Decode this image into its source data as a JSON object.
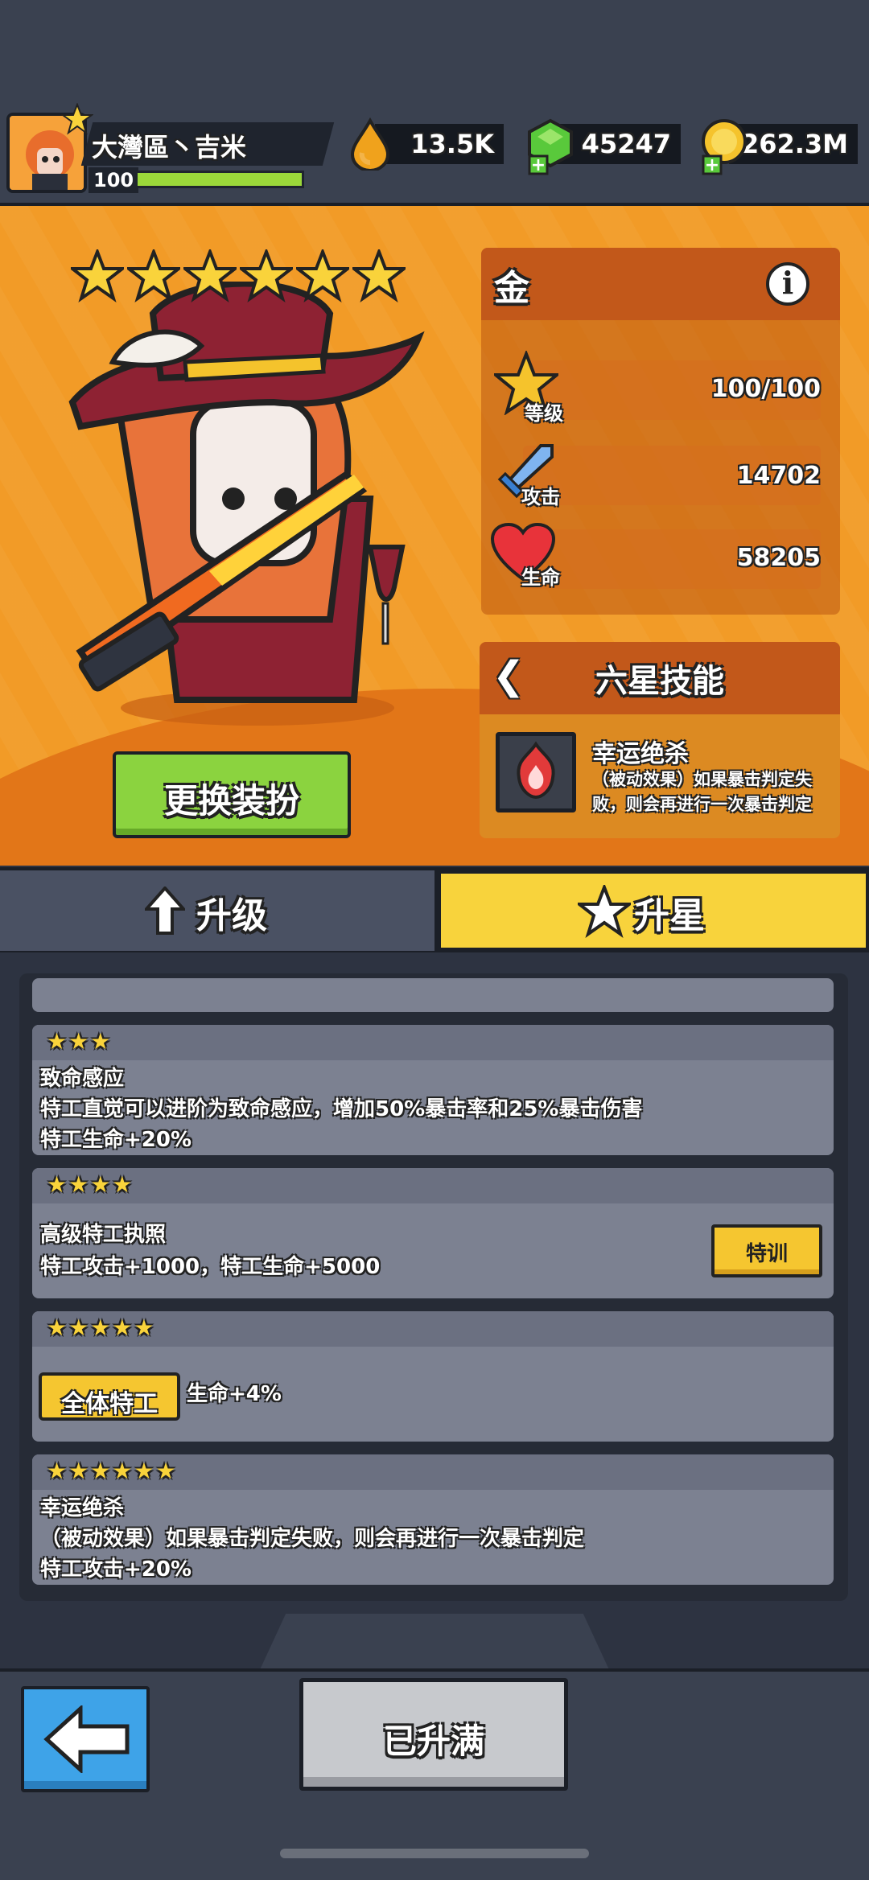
{
  "player": {
    "name": "大灣區丶吉米",
    "level": "100",
    "xp_fraction": 1.0
  },
  "resources": {
    "elixir": "13.5K",
    "gems": "45247",
    "coins": "262.3M"
  },
  "hero": {
    "stars": 6,
    "skin_button": "更换装扮"
  },
  "stats": {
    "title": "金",
    "level_label": "等级",
    "level_value": "100/100",
    "attack_label": "攻击",
    "attack_value": "14702",
    "hp_label": "生命",
    "hp_value": "58205"
  },
  "skill": {
    "title": "六星技能",
    "name": "幸运绝杀",
    "desc": "（被动效果）如果暴击判定失败，则会再进行一次暴击判定"
  },
  "tabs": {
    "upgrade": "升级",
    "star_up": "升星"
  },
  "list": {
    "c3": {
      "stars": "★★★",
      "l1": "致命感应",
      "l2": "特工直觉可以进阶为致命感应，增加50%暴击率和25%暴击伤害",
      "l3": "特工生命+20%"
    },
    "c4": {
      "stars": "★★★★",
      "l1": "高级特工执照",
      "l2": "特工攻击+1000，特工生命+5000",
      "button": "特训"
    },
    "c5": {
      "stars": "★★★★★",
      "badge": "全体特工",
      "l1": "生命+4%"
    },
    "c6": {
      "stars": "★★★★★★",
      "l1": "幸运绝杀",
      "l2": "（被动效果）如果暴击判定失败，则会再进行一次暴击判定",
      "l3": "特工攻击+20%"
    }
  },
  "footer": {
    "maxed": "已升满"
  },
  "colors": {
    "accent_orange": "#f29b27",
    "tab_active": "#f8d33c",
    "button_green": "#8bd33f",
    "back_blue": "#3ea3e8"
  }
}
